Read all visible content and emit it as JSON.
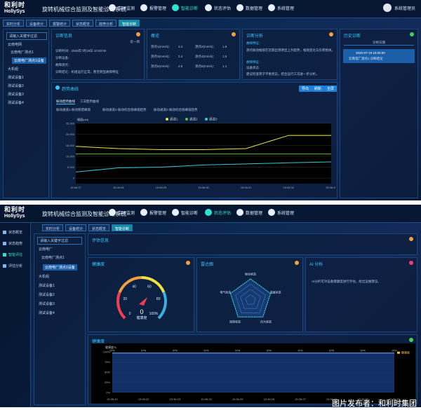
{
  "brand": {
    "logo_cn": "和利时",
    "logo_en": "HollySys",
    "title": "旋转机械综合监测及智能诊断系统"
  },
  "screen1": {
    "nav": [
      {
        "label": "实时监测"
      },
      {
        "label": "报警管理"
      },
      {
        "label": "智能诊断"
      },
      {
        "label": "状态评估"
      },
      {
        "label": "数据管理"
      },
      {
        "label": "系统管理"
      }
    ],
    "user": "系统管理员",
    "tabs": [
      {
        "label": "实时分析"
      },
      {
        "label": "设备统计"
      },
      {
        "label": "报警统计"
      },
      {
        "label": "状态概览"
      },
      {
        "label": "趋势分析"
      },
      {
        "label": "智能诊断"
      }
    ],
    "tree": {
      "search": "请输入关键字过滤",
      "items": [
        "云南电网",
        "云南电厂测点1",
        "云南电厂测点1设备",
        "大机组",
        "测试设备1",
        "测试设备2",
        "测试设备3",
        "测试设备4"
      ]
    },
    "diag_info": {
      "title": "诊断信息",
      "period": "近一周",
      "rows": [
        "诊断时间：2020年7月19日 10:00:00",
        "诊断设备：",
        "故障测点：",
        "诊断结论：机组运行正常，暂无明显故障特征"
      ]
    },
    "overview": {
      "title": "概览",
      "cells": [
        "测点1(mm/s)：",
        "3.2",
        "测点2(mm/s)：",
        "1.8",
        "测点3(mm/s)：",
        "2.4",
        "测点4(mm/s)：",
        "1.5",
        "测点5(mm/s)：",
        "2.9",
        "测点6(mm/s)：",
        "1.1"
      ]
    },
    "analysis": {
      "title": "诊断分析",
      "lines": [
        "故障特征：",
        "测点振动幅值在近期出现明显上升趋势，幅值变化与负荷相关。",
        "故障特征：",
        "设备状态",
        "建议检查转子平衡状态，结合运行工况进一步分析。"
      ]
    },
    "history": {
      "title": "历史诊断",
      "header": "诊断日期",
      "entry": "2020-07-19 10:00:00",
      "entry2": "云南电厂测点1 诊断结论"
    },
    "trend": {
      "title": "趋势曲线",
      "buttons": [
        "导出",
        "刷新",
        "全屏"
      ],
      "subtabs": [
        "振动趋势曲线",
        "工况趋势曲线"
      ],
      "checks": [
        "振动通道1-振动频谱峰值",
        "振动通道1-振动综合值峰值趋势",
        "振动通道2-振动综合值峰值趋势"
      ],
      "legend": [
        "通道1",
        "通道2",
        "通道3"
      ],
      "ylabel": "幅值(um)"
    }
  },
  "screen2": {
    "tabs": [
      {
        "label": "实时分析"
      },
      {
        "label": "设备统计"
      },
      {
        "label": "状态概览"
      },
      {
        "label": "智能诊断"
      }
    ],
    "sidenav": [
      {
        "label": "状态概览"
      },
      {
        "label": "状态趋势"
      },
      {
        "label": "智能评估"
      },
      {
        "label": "评估分析"
      }
    ],
    "tree": {
      "search": "请输入关键字过滤",
      "items": [
        "云南电厂",
        "云南电厂测点1",
        "云南电厂测点1设备",
        "大机组",
        "测试设备1",
        "测试设备2",
        "测试设备3",
        "测试设备4"
      ]
    },
    "info_title": "评估信息",
    "gauge": {
      "title": "健康度",
      "value": "0",
      "unit": "健康度",
      "ticks": [
        "0",
        "20",
        "40",
        "60",
        "80",
        "100%"
      ]
    },
    "radar": {
      "title": "雷达图",
      "labels": [
        "振动状态",
        "温度状态",
        "压力状态",
        "润滑状态",
        "电气状态"
      ]
    },
    "ai": {
      "title": "AI 分析",
      "text": "AI分析可对设备健康度进行评估，给出运维建议。"
    },
    "trend2": {
      "title": "健康度",
      "ylabel": "健康度%",
      "legend": "健康度"
    }
  },
  "watermark": "图片发布者：和利时集团",
  "chart_data": [
    {
      "type": "line",
      "title": "",
      "ylabel": "幅值(um)",
      "ylim": [
        -2500,
        25000
      ],
      "x": [
        "15:06:27",
        "15:06:28",
        "15:06:29",
        "15:06:30",
        "15:06:31",
        "15:06:32",
        "15:06:33"
      ],
      "series": [
        {
          "name": "通道1",
          "values": [
            14500,
            13500,
            13000,
            13000,
            13500,
            19500,
            19500
          ]
        },
        {
          "name": "通道2",
          "values": [
            11000,
            11000,
            11000,
            11000,
            11000,
            11000,
            11000
          ]
        },
        {
          "name": "通道3",
          "values": [
            2800,
            4700,
            5000,
            6000,
            6500,
            7000,
            7400
          ]
        }
      ]
    },
    {
      "type": "line",
      "title": "",
      "ylabel": "健康度%",
      "ylim": [
        0,
        100
      ],
      "x": [
        "15:36:10",
        "15:36:22",
        "15:36:23",
        "15:36:24",
        "15:36:25",
        "15:36:26",
        "15:36:27",
        "15:36:28",
        "15:36:29",
        "15:36:30"
      ],
      "series": [
        {
          "name": "健康度",
          "values": [
            97,
            97,
            97,
            97,
            97,
            97,
            97,
            97,
            97,
            97
          ]
        }
      ]
    }
  ],
  "colors": {
    "accent": "#2fe0d0",
    "line1": "#e8e84a",
    "line2": "#5fc23a",
    "line3": "#3ac7d8",
    "title": "#36c7ff"
  }
}
